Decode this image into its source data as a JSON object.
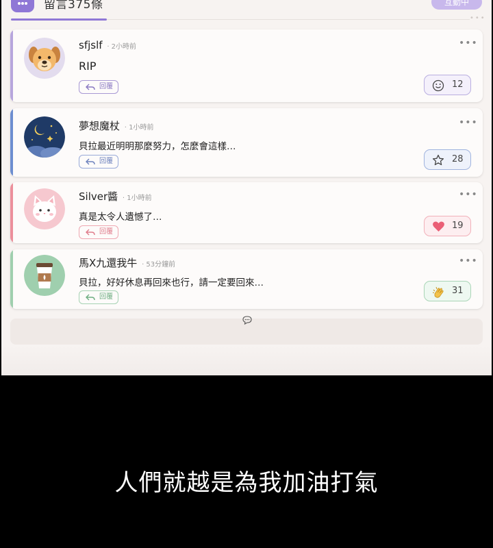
{
  "header": {
    "title": "留言375條",
    "live_badge": "互動中"
  },
  "comments": [
    {
      "username": "sfjslf",
      "time": "· 2小時前",
      "message": "RIP",
      "reply_label": "回覆",
      "reaction": {
        "icon": "smile-icon",
        "count": "12"
      },
      "accent": "#b7a6dd"
    },
    {
      "username": "夢想魔杖",
      "time": "· 1小時前",
      "message": "貝拉最近明明那麼努力，怎麼會這樣…",
      "reply_label": "回覆",
      "reaction": {
        "icon": "star-icon",
        "count": "28"
      },
      "accent": "#6d8ed0"
    },
    {
      "username": "Silver醬",
      "time": "· 1小時前",
      "message": "真是太令人遺憾了…",
      "reply_label": "回覆",
      "reaction": {
        "icon": "heart-icon",
        "count": "19"
      },
      "accent": "#ec8f9b"
    },
    {
      "username": "馬X九還我牛",
      "time": "· 53分鐘前",
      "message": "貝拉，好好休息再回來也行，請一定要回來…",
      "reply_label": "回覆",
      "reaction": {
        "icon": "clapping-hands-icon",
        "count": "31"
      },
      "accent": "#9fcfae"
    }
  ],
  "caption": "人們就越是為我加油打氣"
}
